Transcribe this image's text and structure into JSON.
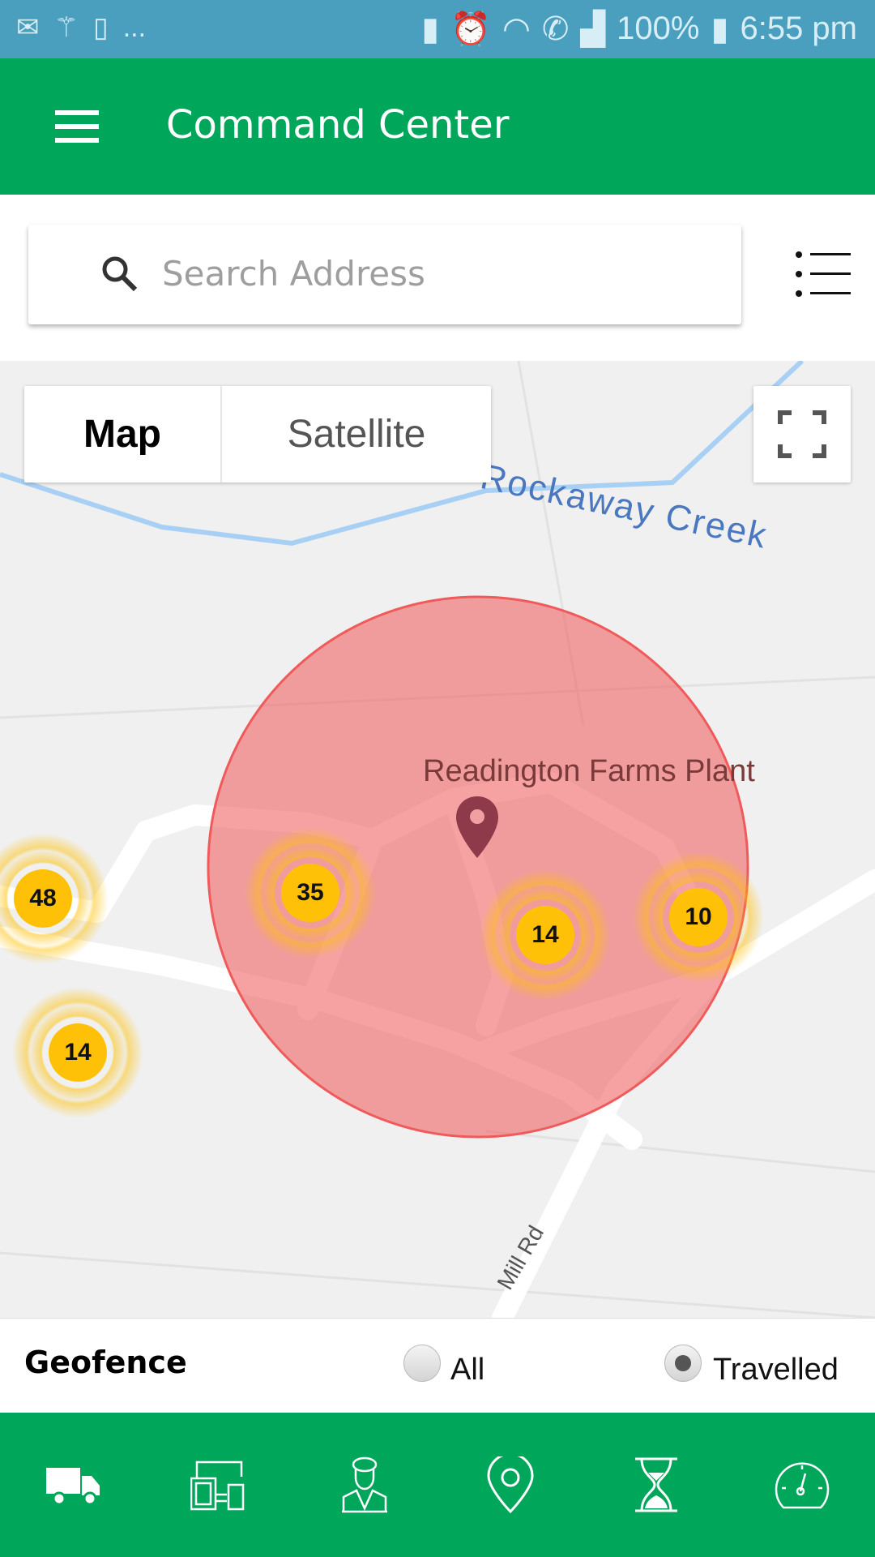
{
  "status_bar": {
    "time": "6:55 pm",
    "battery": "100%",
    "more": "..."
  },
  "app_bar": {
    "title": "Command Center"
  },
  "search": {
    "placeholder": "Search Address"
  },
  "map": {
    "toggle": {
      "map": "Map",
      "satellite": "Satellite",
      "selected": "Map"
    },
    "labels": {
      "creek": "Rockaway Creek",
      "place": "Readington Farms Plant",
      "road": "Mill Rd"
    },
    "geofence_color": "#f28b8b",
    "clusters": [
      {
        "count": "48"
      },
      {
        "count": "35"
      },
      {
        "count": "14"
      },
      {
        "count": "10"
      },
      {
        "count": "14"
      }
    ]
  },
  "geofence": {
    "label": "Geofence",
    "options": [
      {
        "label": "All",
        "selected": false
      },
      {
        "label": "Travelled",
        "selected": true
      }
    ]
  },
  "bottom_nav": {
    "items": [
      "truck-icon",
      "devices-icon",
      "driver-icon",
      "location-pin-icon",
      "hourglass-icon",
      "speedometer-icon"
    ]
  },
  "colors": {
    "primary": "#00a65a",
    "status_bar": "#4a9fbf",
    "cluster": "#ffc107"
  }
}
